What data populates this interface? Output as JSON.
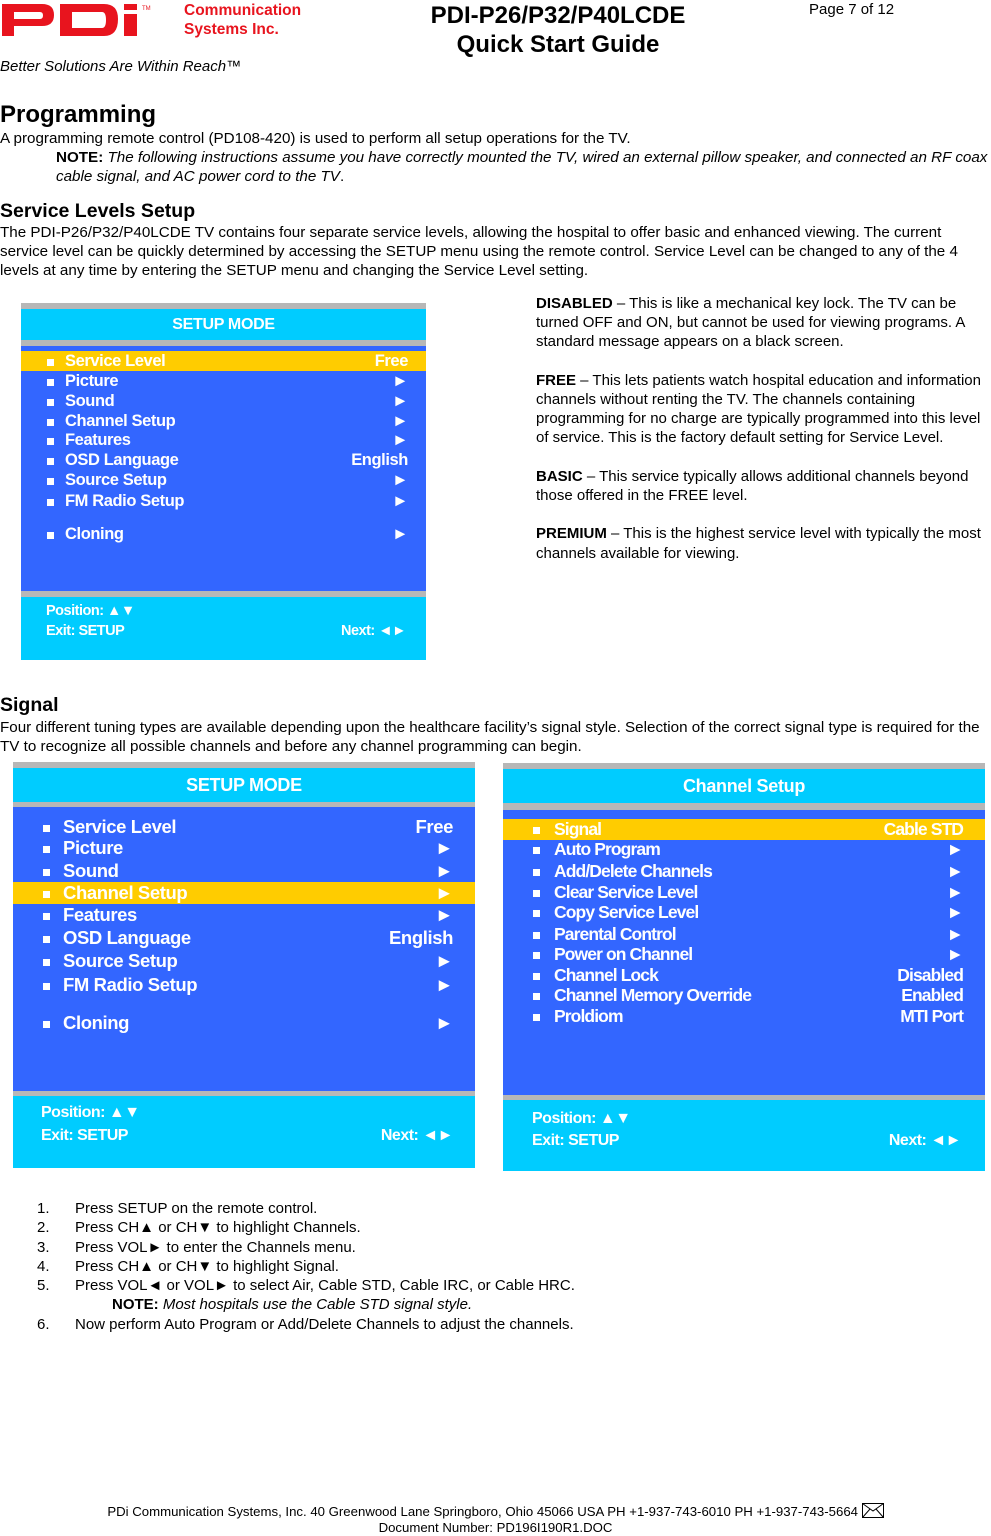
{
  "header": {
    "logo_text": "PDi",
    "logo_tm": "™",
    "company_line1": "Communication",
    "company_line2": "Systems Inc.",
    "title_line1": "PDI-P26/P32/P40LCDE",
    "title_line2": "Quick Start Guide",
    "page": "Page 7 of 12",
    "tagline": "Better Solutions Are Within Reach™",
    "brand_color": "#e8141e"
  },
  "programming": {
    "heading": "Programming",
    "intro": "A programming remote control (PD108-420) is used to perform all setup operations for the TV.",
    "note_label": "NOTE:",
    "note_text": " The following instructions assume you have correctly mounted the TV, wired an external pillow speaker, and connected an RF coax cable signal, and AC power cord to the TV",
    "note_end": "."
  },
  "service_levels": {
    "heading": "Service Levels Setup",
    "body": "The PDI-P26/P32/P40LCDE TV contains four separate service levels, allowing the hospital to offer basic and enhanced viewing.  The current service level can be quickly determined by accessing the SETUP menu using the remote control.  Service Level can be changed to any of the 4 levels at any time by entering the SETUP menu and changing the Service Level setting.",
    "levels": [
      {
        "name": "DISABLED",
        "text": " – This is like a mechanical key lock. The TV can be turned OFF and ON, but cannot be used for viewing programs.  A standard message appears on a black screen."
      },
      {
        "name": "FREE",
        "text": " – This lets patients watch hospital education and information channels without renting the TV.  The channels containing programming for no charge are typically programmed into this level of service.  This is the factory default setting for Service Level."
      },
      {
        "name": "BASIC",
        "text": " – This service typically allows additional channels beyond those offered in the FREE level."
      },
      {
        "name": "PREMIUM",
        "text": " – This is the highest service level with typically the most channels available for viewing."
      }
    ]
  },
  "menu_colors": {
    "title_bg": "#00ccff",
    "body_bg": "#3366ff",
    "highlight_bg": "#ffcc00",
    "frame": "#b7b7b7"
  },
  "setup_menu_1": {
    "title": "SETUP MODE",
    "items": [
      {
        "label": "Service Level",
        "value": "Free",
        "highlighted": true
      },
      {
        "label": "Picture",
        "value": "►"
      },
      {
        "label": "Sound",
        "value": "►"
      },
      {
        "label": "Channel Setup",
        "value": "►"
      },
      {
        "label": "Features",
        "value": "►"
      },
      {
        "label": "OSD Language",
        "value": "English"
      },
      {
        "label": "Source Setup",
        "value": "►"
      },
      {
        "label": "FM Radio Setup",
        "value": "►"
      },
      {
        "label": "Cloning",
        "value": "►"
      }
    ],
    "footer_position": "Position: ▲▼",
    "footer_exit": "Exit: SETUP",
    "footer_next": "Next: ◄►"
  },
  "signal": {
    "heading": "Signal",
    "body": "Four different tuning types are available depending upon the healthcare facility’s signal style. Selection of the correct signal type is required for the TV to recognize all possible channels and before any channel programming can begin."
  },
  "setup_menu_2": {
    "title": "SETUP MODE",
    "items": [
      {
        "label": "Service Level",
        "value": "Free"
      },
      {
        "label": "Picture",
        "value": "►"
      },
      {
        "label": "Sound",
        "value": "►"
      },
      {
        "label": "Channel Setup",
        "value": "►",
        "highlighted": true
      },
      {
        "label": "Features",
        "value": "►"
      },
      {
        "label": "OSD Language",
        "value": "English"
      },
      {
        "label": "Source Setup",
        "value": "►"
      },
      {
        "label": "FM Radio Setup",
        "value": "►"
      },
      {
        "label": "Cloning",
        "value": "►"
      }
    ],
    "footer_position": "Position: ▲▼",
    "footer_exit": "Exit: SETUP",
    "footer_next": "Next: ◄►"
  },
  "channel_setup_menu": {
    "title": "Channel Setup",
    "items": [
      {
        "label": "Signal",
        "value": "Cable STD",
        "highlighted": true
      },
      {
        "label": "Auto Program",
        "value": "►"
      },
      {
        "label": "Add/Delete Channels",
        "value": "►"
      },
      {
        "label": "Clear Service Level",
        "value": "►"
      },
      {
        "label": "Copy Service Level",
        "value": "►"
      },
      {
        "label": "Parental Control",
        "value": "►"
      },
      {
        "label": "Power on Channel",
        "value": "►"
      },
      {
        "label": "Channel Lock",
        "value": "Disabled"
      },
      {
        "label": "Channel Memory Override",
        "value": "Enabled"
      },
      {
        "label": "Proldiom",
        "value": "MTI Port"
      }
    ],
    "footer_position": "Position: ▲▼",
    "footer_exit": "Exit: SETUP",
    "footer_next": "Next: ◄►"
  },
  "steps": [
    {
      "num": "1.",
      "text": "Press SETUP on the remote control."
    },
    {
      "num": "2.",
      "text": "Press CH▲ or CH▼ to highlight Channels."
    },
    {
      "num": "3.",
      "text": "Press VOL► to enter the Channels menu."
    },
    {
      "num": "4.",
      "text": "Press CH▲ or CH▼ to highlight Signal."
    },
    {
      "num": "5.",
      "text": "Press VOL◄ or VOL► to select Air, Cable STD, Cable IRC, or Cable HRC."
    },
    {
      "num": "6.",
      "text": "Now perform Auto Program or Add/Delete Channels to adjust the channels."
    }
  ],
  "steps_note": {
    "label": "NOTE:",
    "text": " Most hospitals use the Cable STD signal style."
  },
  "footer": {
    "line1": "PDi Communication Systems, Inc.   40 Greenwood Lane   Springboro, Ohio 45066 USA   PH +1-937-743-6010 PH +1-937-743-5664 ",
    "line2": "Document Number:  PD196I190R1.DOC",
    "mail_icon": "envelope-icon"
  }
}
